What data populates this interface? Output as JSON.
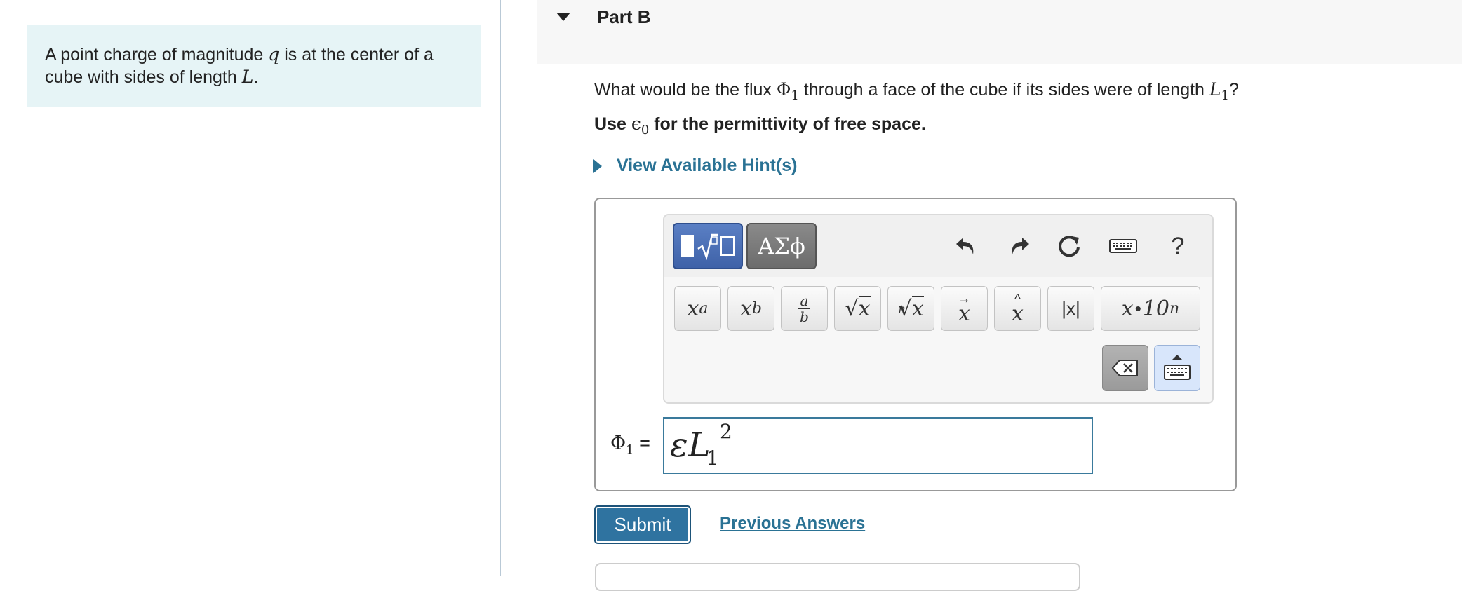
{
  "intro": {
    "line1_pre": "A point charge of magnitude ",
    "line1_var": "q",
    "line1_post": " is at the center of a",
    "line2_pre": "cube with sides of length ",
    "line2_var": "L",
    "line2_post": "."
  },
  "part": {
    "title": "Part B"
  },
  "question": {
    "pre": "What would be the flux ",
    "flux_symbol": "Φ",
    "flux_sub": "1",
    "mid": " through a face of the cube if its sides were of length ",
    "length_var": "L",
    "length_sub": "1",
    "post": "?"
  },
  "instruction": {
    "pre": "Use ",
    "epsilon": "ϵ",
    "epsilon_sub": "0",
    "post": " for the permittivity of free space."
  },
  "hint": {
    "label": "View Available Hint(s)"
  },
  "toolbar": {
    "symbols_label": "ΑΣϕ",
    "help_label": "?",
    "actions": [
      "undo-icon",
      "redo-icon",
      "reset-icon",
      "keyboard-icon",
      "help-icon"
    ],
    "keys": {
      "superscript_base": "x",
      "superscript_exp": "a",
      "subscript_base": "x",
      "subscript_sub": "b",
      "fraction_num": "a",
      "fraction_den": "b",
      "sqrt_arg": "x",
      "nthroot_index": "n",
      "nthroot_arg": "x",
      "vector_arg": "x",
      "unitvec_arg": "x",
      "abs_label": "|x|",
      "sci_base": "x",
      "sci_dot": "•",
      "sci_ten": "10",
      "sci_exp": "n"
    }
  },
  "answer": {
    "label_symbol": "Φ",
    "label_sub": "1",
    "label_equals": " =",
    "expr_main": "εL",
    "expr_sub": "1",
    "expr_exp": "2"
  },
  "actions": {
    "submit_label": "Submit",
    "previous_label": "Previous Answers"
  },
  "colors": {
    "intro_bg": "#e6f4f6",
    "link": "#2a7294",
    "submit_bg": "#2f73a0",
    "template_btn": "#4a6fb8",
    "input_border": "#3a7a9c"
  }
}
